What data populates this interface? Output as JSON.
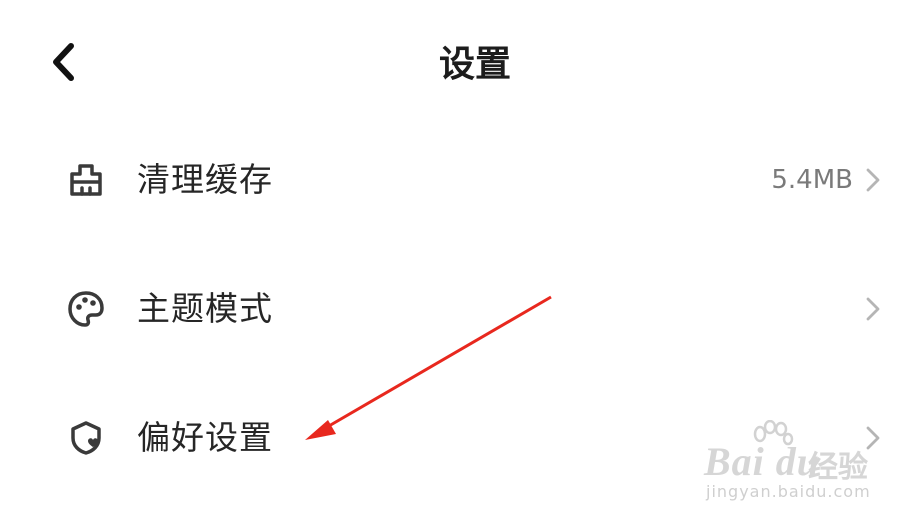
{
  "header": {
    "back_icon": "chevron-left-icon",
    "title": "设置"
  },
  "settings": [
    {
      "icon": "broom-clean-icon",
      "label": "清理缓存",
      "value": "5.4MB"
    },
    {
      "icon": "palette-icon",
      "label": "主题模式",
      "value": ""
    },
    {
      "icon": "shield-heart-icon",
      "label": "偏好设置",
      "value": ""
    }
  ],
  "annotation": {
    "color": "#e8281e"
  },
  "watermark": {
    "brand": "Bai du",
    "sub": "经验",
    "url": "jingyan.baidu.com"
  }
}
